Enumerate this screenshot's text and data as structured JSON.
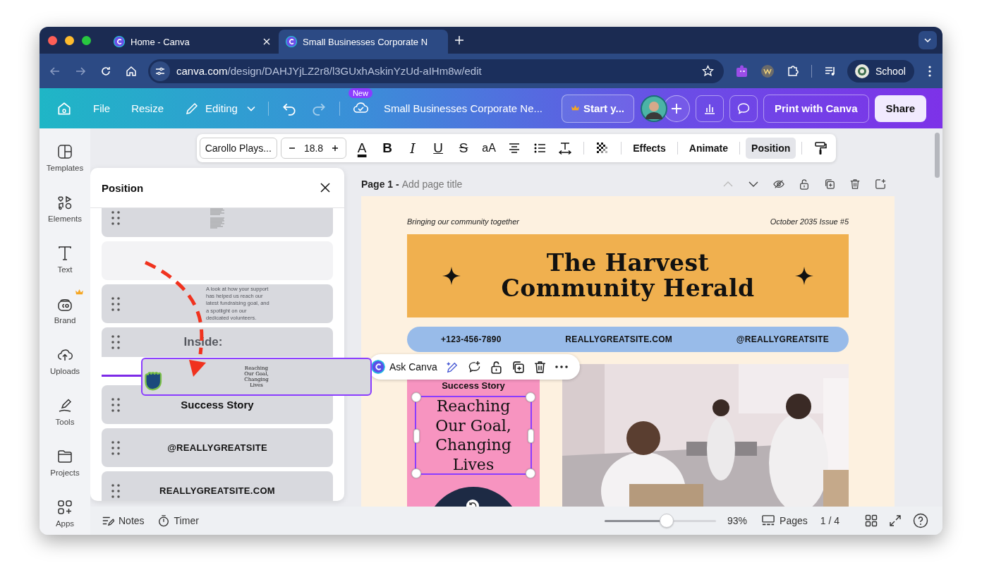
{
  "browser": {
    "tabs": [
      {
        "title": "Home - Canva",
        "selected": false
      },
      {
        "title": "Small Businesses Corporate N",
        "selected": true
      }
    ],
    "url": {
      "host": "canva.com",
      "path": "/design/DAHJYjLZ2r8/l3GUxhAskinYzUd-aIHm8w/edit"
    },
    "profile": "School"
  },
  "header": {
    "menu": [
      "File",
      "Resize"
    ],
    "mode": "Editing",
    "badge": "New",
    "title": "Small Businesses Corporate Ne...",
    "trial": "Start y...",
    "print": "Print with Canva",
    "share": "Share"
  },
  "text_toolbar": {
    "font": "Carollo Plays...",
    "size": "18.8",
    "format": [
      {
        "glyph": "A",
        "kind": "color"
      },
      {
        "glyph": "B",
        "kind": "bold"
      },
      {
        "glyph": "I",
        "kind": "italic"
      },
      {
        "glyph": "U",
        "kind": "underline"
      },
      {
        "glyph": "S",
        "kind": "strike"
      },
      {
        "glyph": "aA",
        "kind": "case"
      }
    ],
    "items": [
      {
        "label": "Effects",
        "selected": false
      },
      {
        "label": "Animate",
        "selected": false
      },
      {
        "label": "Position",
        "selected": true
      }
    ]
  },
  "sidebar": [
    {
      "label": "Templates",
      "premium": false
    },
    {
      "label": "Elements",
      "premium": false
    },
    {
      "label": "Text",
      "premium": false
    },
    {
      "label": "Brand",
      "premium": true
    },
    {
      "label": "Uploads",
      "premium": false
    },
    {
      "label": "Tools",
      "premium": false
    },
    {
      "label": "Projects",
      "premium": false
    },
    {
      "label": "Apps",
      "premium": false
    }
  ],
  "position_panel": {
    "title": "Position",
    "layers": [
      {
        "kind": "thumbnail"
      },
      {
        "kind": "slot"
      },
      {
        "kind": "caption",
        "text": "A look at how your support has helped us reach our latest fundraising goal, and a spotlight on our dedicated volunteers."
      },
      {
        "kind": "heading",
        "text": "Inside:"
      },
      {
        "kind": "drop"
      },
      {
        "kind": "label",
        "text": "Success Story",
        "large": true
      },
      {
        "kind": "label",
        "text": "@REALLYGREATSITE",
        "large": false
      },
      {
        "kind": "label",
        "text": "REALLYGREATSITE.COM",
        "large": false
      }
    ],
    "dragging": [
      "Reaching",
      "Our Goal,",
      "Changing",
      "Lives"
    ]
  },
  "page": {
    "label": "Page 1 -",
    "title_placeholder": "Add page title",
    "tagline": "Bringing our community together",
    "issue": "October 2035 Issue #5",
    "title_lines": [
      "The Harvest",
      "Community Herald"
    ],
    "contacts": [
      "+123-456-7890",
      "REALLYGREATSITE.COM",
      "@REALLYGREATSITE"
    ],
    "story_label": "Success Story",
    "story_title": [
      "Reaching",
      "Our Goal,",
      "Changing",
      "Lives"
    ]
  },
  "element_toolbar": {
    "ask": "Ask Canva"
  },
  "footer": {
    "notes": "Notes",
    "timer": "Timer",
    "zoom": {
      "level": 0.56,
      "reading": "93%"
    },
    "pages": "Pages",
    "page_count": "1 / 4"
  }
}
